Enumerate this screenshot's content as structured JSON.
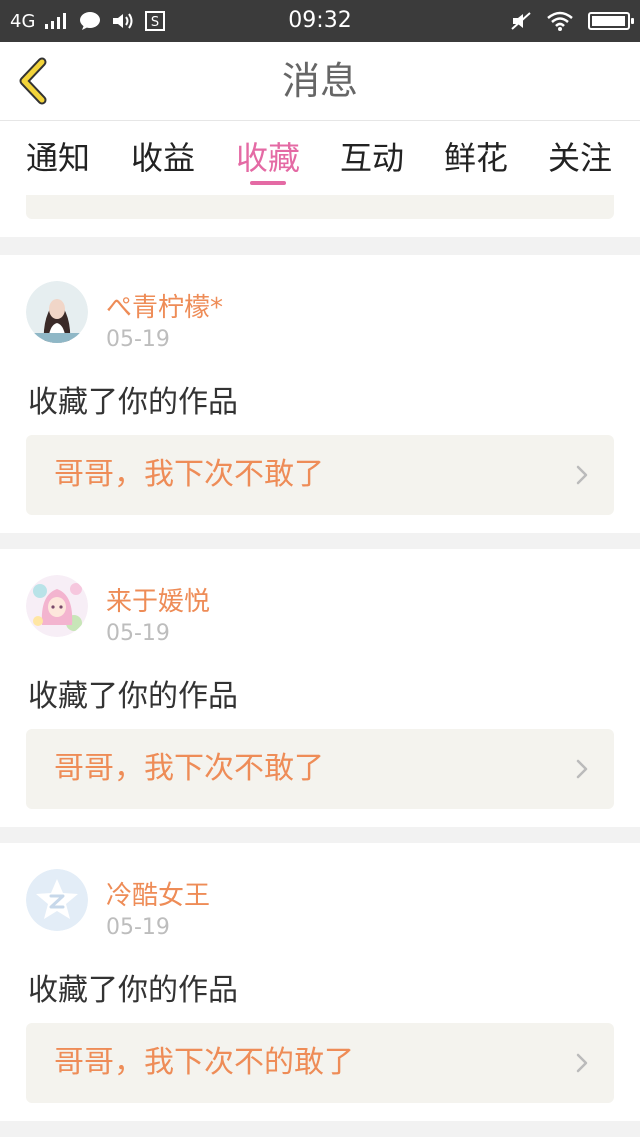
{
  "status_bar": {
    "network": "4G",
    "time": "09:32"
  },
  "header": {
    "title": "消息"
  },
  "tabs": [
    {
      "label": "通知",
      "active": false
    },
    {
      "label": "收益",
      "active": false
    },
    {
      "label": "收藏",
      "active": true
    },
    {
      "label": "互动",
      "active": false
    },
    {
      "label": "鲜花",
      "active": false
    },
    {
      "label": "关注",
      "active": false
    }
  ],
  "colors": {
    "accent_pink": "#e46aa4",
    "accent_orange": "#ee8c57",
    "quote_bg": "#f4f3ee"
  },
  "items": [
    {
      "username": "ぺ青柠檬*",
      "date": "05-19",
      "action": "收藏了你的作品",
      "work_title": "哥哥，我下次不敢了",
      "avatar": "photo-avatar"
    },
    {
      "username": "来于媛悦",
      "date": "05-19",
      "action": "收藏了你的作品",
      "work_title": "哥哥，我下次不敢了",
      "avatar": "anime-avatar"
    },
    {
      "username": "冷酷女王",
      "date": "05-19",
      "action": "收藏了你的作品",
      "work_title": "哥哥，我下次不的敢了",
      "avatar": "default-avatar"
    }
  ]
}
